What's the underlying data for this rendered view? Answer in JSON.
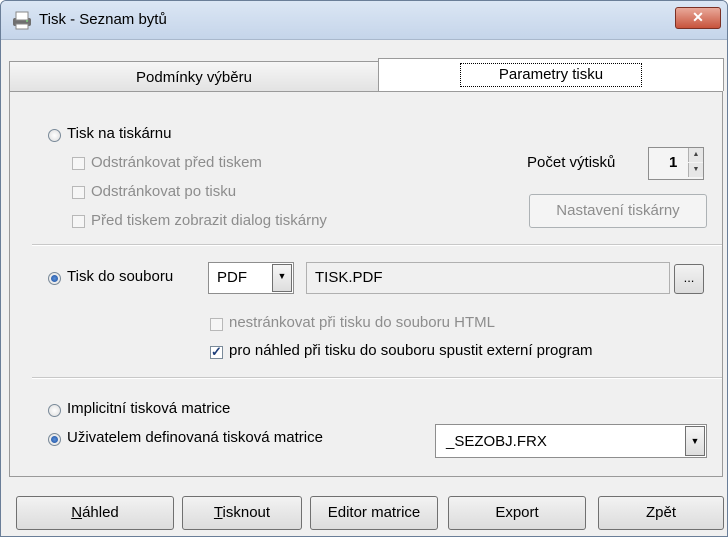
{
  "window": {
    "title": "Tisk - Seznam bytů",
    "close_label": "✕"
  },
  "tabs": {
    "conditions": "Podmínky výběru",
    "params": "Parametry tisku"
  },
  "printer": {
    "radio_label": "Tisk na tiskárnu",
    "opt1": "Odstránkovat před tiskem",
    "opt2": "Odstránkovat po tisku",
    "opt3": "Před tiskem zobrazit dialog tiskárny",
    "copies_label": "Počet výtisků",
    "copies_value": "1",
    "settings_button": "Nastavení tiskárny"
  },
  "file": {
    "radio_label": "Tisk do souboru",
    "format_value": "PDF",
    "filename_value": "TISK.PDF",
    "browse_label": "...",
    "opt_nopaging": "nestránkovat při tisku do souboru HTML",
    "opt_external": "pro náhled při tisku do souboru spustit externí program"
  },
  "matrix": {
    "implicit_label": "Implicitní tisková matrice",
    "user_label": "Uživatelem definovaná tisková matrice",
    "user_value": "_SEZOBJ.FRX"
  },
  "footer": {
    "preview_mn": "N",
    "preview_rest": "áhled",
    "print_mn": "T",
    "print_rest": "isknout",
    "editor": "Editor matrice",
    "export": "Export",
    "back": "Zpět"
  }
}
